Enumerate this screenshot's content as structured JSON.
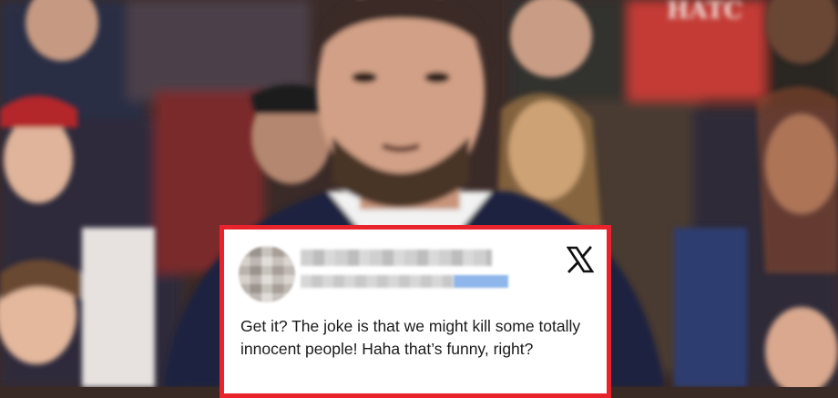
{
  "tweet": {
    "text": "Get it? The joke is that we might kill some totally innocent people! Haha that’s funny, right?",
    "platform_icon": "x-logo-icon"
  },
  "colors": {
    "card_border": "#e8232b",
    "card_background": "#ffffff",
    "text": "#1a1a1a"
  }
}
